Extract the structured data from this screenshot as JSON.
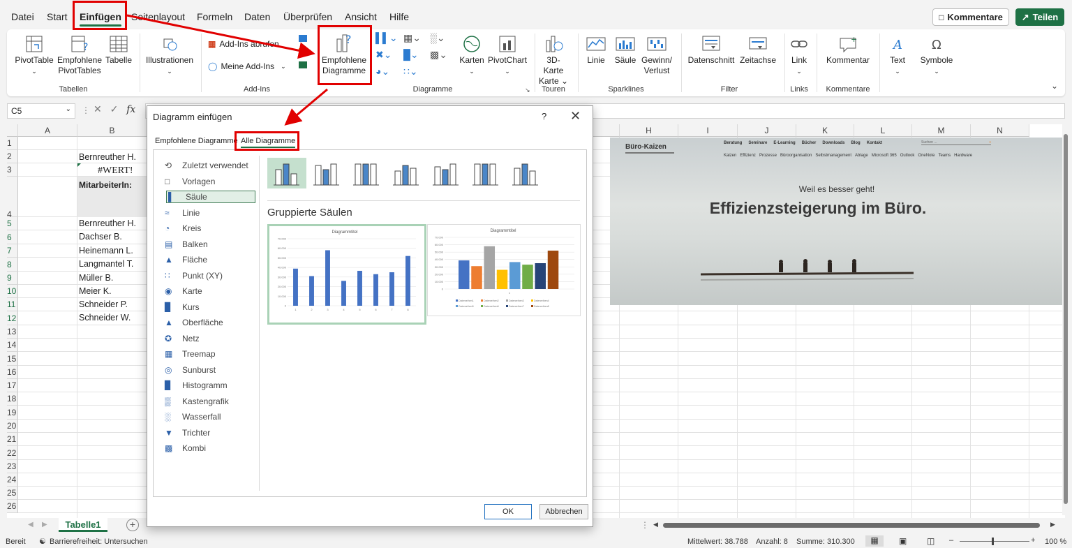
{
  "menu": {
    "tabs": [
      "Datei",
      "Start",
      "Einfügen",
      "Seitenlayout",
      "Formeln",
      "Daten",
      "Überprüfen",
      "Ansicht",
      "Hilfe"
    ],
    "active_tab": "Einfügen",
    "kommentare": "Kommentare",
    "teilen": "Teilen"
  },
  "ribbon": {
    "pivottable": "PivotTable",
    "empf_pivot": "Empfohlene PivotTables",
    "tabelle": "Tabelle",
    "illustrationen": "Illustrationen",
    "addins_abrufen": "Add-Ins abrufen",
    "meine_addins": "Meine Add-Ins",
    "empf_diagramme": "Empfohlene Diagramme",
    "karten": "Karten",
    "pivotchart": "PivotChart",
    "karte3d": "3D-Karte",
    "linie": "Linie",
    "saeule": "Säule",
    "gewinn": "Gewinn/ Verlust",
    "datenschnitt": "Datenschnitt",
    "zeitachse": "Zeitachse",
    "link": "Link",
    "kommentar": "Kommentar",
    "text": "Text",
    "symbole": "Symbole",
    "groups": {
      "tabellen": "Tabellen",
      "addins": "Add-Ins",
      "diagramme": "Diagramme",
      "touren": "Touren",
      "sparklines": "Sparklines",
      "filter": "Filter",
      "links": "Links",
      "kommentare": "Kommentare"
    }
  },
  "formula_bar": {
    "name_box": "C5",
    "fx": "fx"
  },
  "columns": [
    "A",
    "B",
    "C",
    "D",
    "E",
    "F",
    "G",
    "H",
    "I",
    "J",
    "K",
    "L",
    "M",
    "N"
  ],
  "rows": [
    "1",
    "2",
    "3",
    "4",
    "5",
    "6",
    "7",
    "8",
    "9",
    "10",
    "11",
    "12",
    "13",
    "14",
    "15",
    "16",
    "17",
    "18",
    "19",
    "20",
    "21",
    "22",
    "23",
    "24",
    "25",
    "26"
  ],
  "cells": {
    "b2": "Bernreuther H.",
    "b3": "#WERT!",
    "b4": "MitarbeiterIn:",
    "names": [
      "Bernreuther H.",
      "Dachser B.",
      "Heinemann L.",
      "Langmantel T.",
      "Müller B.",
      "Meier K.",
      "Schneider P.",
      "Schneider W."
    ]
  },
  "website": {
    "logo": "Büro-Kaizen",
    "nav1": [
      "Beratung",
      "Seminare",
      "E-Learning",
      "Bücher",
      "Downloads",
      "Blog",
      "Kontakt"
    ],
    "search_placeholder": "Suchen ...",
    "nav2": [
      "Kaizen",
      "Effizienz",
      "Prozesse",
      "Büroorganisation",
      "Selbstmanagement",
      "Ablage",
      "Microsoft 365",
      "Outlook",
      "OneNote",
      "Teams",
      "Hardware"
    ],
    "tagline": "Weil es besser geht!",
    "headline": "Effizienzsteigerung im Büro."
  },
  "dialog": {
    "title": "Diagramm einfügen",
    "help": "?",
    "tab_recommended": "Empfohlene Diagramme",
    "tab_all": "Alle Diagramme",
    "categories": [
      "Zuletzt verwendet",
      "Vorlagen",
      "Säule",
      "Linie",
      "Kreis",
      "Balken",
      "Fläche",
      "Punkt (XY)",
      "Karte",
      "Kurs",
      "Oberfläche",
      "Netz",
      "Treemap",
      "Sunburst",
      "Histogramm",
      "Kastengrafik",
      "Wasserfall",
      "Trichter",
      "Kombi"
    ],
    "selected_category": "Säule",
    "subtype_title": "Gruppierte Säulen",
    "preview_title": "Diagrammtitel",
    "ok": "OK",
    "cancel": "Abbrechen"
  },
  "chart_data": [
    {
      "type": "bar",
      "title": "Diagrammtitel",
      "categories": [
        "1",
        "2",
        "3",
        "4",
        "5",
        "6",
        "7",
        "8"
      ],
      "values": [
        38788,
        31000,
        58000,
        26000,
        36500,
        33000,
        35000,
        52000
      ],
      "ylim": [
        0,
        70000
      ],
      "yticks": [
        "0",
        "10.000",
        "20.000",
        "30.000",
        "40.000",
        "50.000",
        "60.000",
        "70.000"
      ]
    },
    {
      "type": "bar",
      "title": "Diagrammtitel",
      "categories": [
        "1"
      ],
      "series": [
        {
          "name": "Datenreihen1",
          "values": [
            38788
          ]
        },
        {
          "name": "Datenreihen2",
          "values": [
            31000
          ]
        },
        {
          "name": "Datenreihen3",
          "values": [
            58000
          ]
        },
        {
          "name": "Datenreihen4",
          "values": [
            26000
          ]
        },
        {
          "name": "Datenreihen5",
          "values": [
            36500
          ]
        },
        {
          "name": "Datenreihen6",
          "values": [
            33000
          ]
        },
        {
          "name": "Datenreihen7",
          "values": [
            35000
          ]
        },
        {
          "name": "Datenreihen8",
          "values": [
            52000
          ]
        }
      ],
      "ylim": [
        0,
        70000
      ],
      "yticks": [
        "0",
        "10.000",
        "20.000",
        "30.000",
        "40.000",
        "50.000",
        "60.000",
        "70.000"
      ],
      "colors": [
        "#4472c4",
        "#ed7d31",
        "#a5a5a5",
        "#ffc000",
        "#5b9bd5",
        "#70ad47",
        "#264478",
        "#9e480e"
      ]
    }
  ],
  "sheet": {
    "tab": "Tabelle1"
  },
  "status": {
    "bereit": "Bereit",
    "barriere": "Barrierefreiheit: Untersuchen",
    "mittelwert": "Mittelwert: 38.788",
    "anzahl": "Anzahl: 8",
    "summe": "Summe: 310.300",
    "zoom": "100 %"
  },
  "colors": {
    "excel_green": "#1e7145",
    "annotation_red": "#e10000",
    "bar_blue": "#4472c4"
  }
}
